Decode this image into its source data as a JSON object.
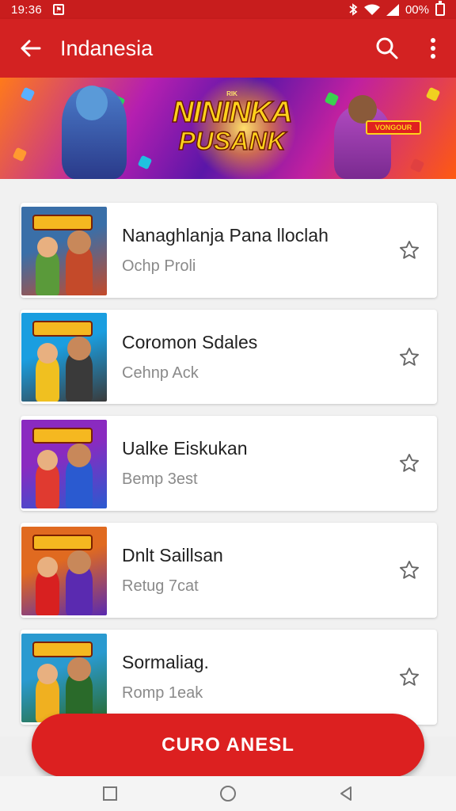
{
  "status_bar": {
    "time": "19:36",
    "battery": "00%"
  },
  "app_bar": {
    "title": "Indanesia"
  },
  "banner": {
    "logo_small": "RIK",
    "logo_line1": "NININKA",
    "logo_line2": "PUSANK",
    "tag_text": "VONGOUR"
  },
  "list": [
    {
      "title": "Nanaghlanja Pana lloclah",
      "subtitle": "Ochp Proli",
      "thumb_colors": [
        "#3a6fa8",
        "#5a9a3a",
        "#c44a2a"
      ]
    },
    {
      "title": "Coromon Sdales",
      "subtitle": "Cehnp Ack",
      "thumb_colors": [
        "#1a9ee0",
        "#f0c020",
        "#3a3a3a"
      ]
    },
    {
      "title": "Ualke Eiskukan",
      "subtitle": "Bemp 3est",
      "thumb_colors": [
        "#8a2ac0",
        "#e03a30",
        "#2a5ad0"
      ]
    },
    {
      "title": "Dnlt Saillsan",
      "subtitle": "Retug 7cat",
      "thumb_colors": [
        "#e06a20",
        "#d82020",
        "#5a2ab0"
      ]
    },
    {
      "title": "Sormaliag.",
      "subtitle": "Romp 1eak",
      "thumb_colors": [
        "#2a9ad0",
        "#f0b020",
        "#2a6a2a"
      ]
    }
  ],
  "fab": {
    "label": "CURO ANESL"
  },
  "colors": {
    "primary": "#d32222",
    "status": "#c81d1d",
    "fab": "#dc2020"
  }
}
